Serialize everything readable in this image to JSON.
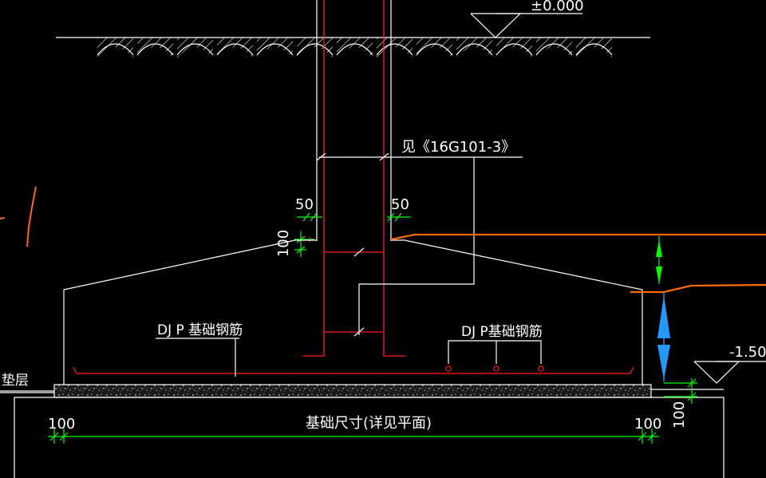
{
  "drawing": {
    "colors": {
      "background": "#000000",
      "outline": "#ffffff",
      "rebar": "#ff2020",
      "dimension": "#00ff00",
      "soil_line": "#ff6a00",
      "arrow_blue": "#2299ff"
    },
    "labels": {
      "ground_elevation": "±0.000",
      "bottom_elevation": "-1.50",
      "reference_note": "见《16G101-3》",
      "rebar_note_left": "DJ P 基础钢筋",
      "rebar_note_right": "DJ P基础钢筋",
      "cushion": "垫层",
      "base_size": "基础尺寸(详见平面)"
    },
    "dimensions": {
      "cover_left": "50",
      "cover_right": "50",
      "top_offset": "100",
      "cushion_thickness": "100",
      "edge_left": "100",
      "edge_right": "100"
    }
  }
}
